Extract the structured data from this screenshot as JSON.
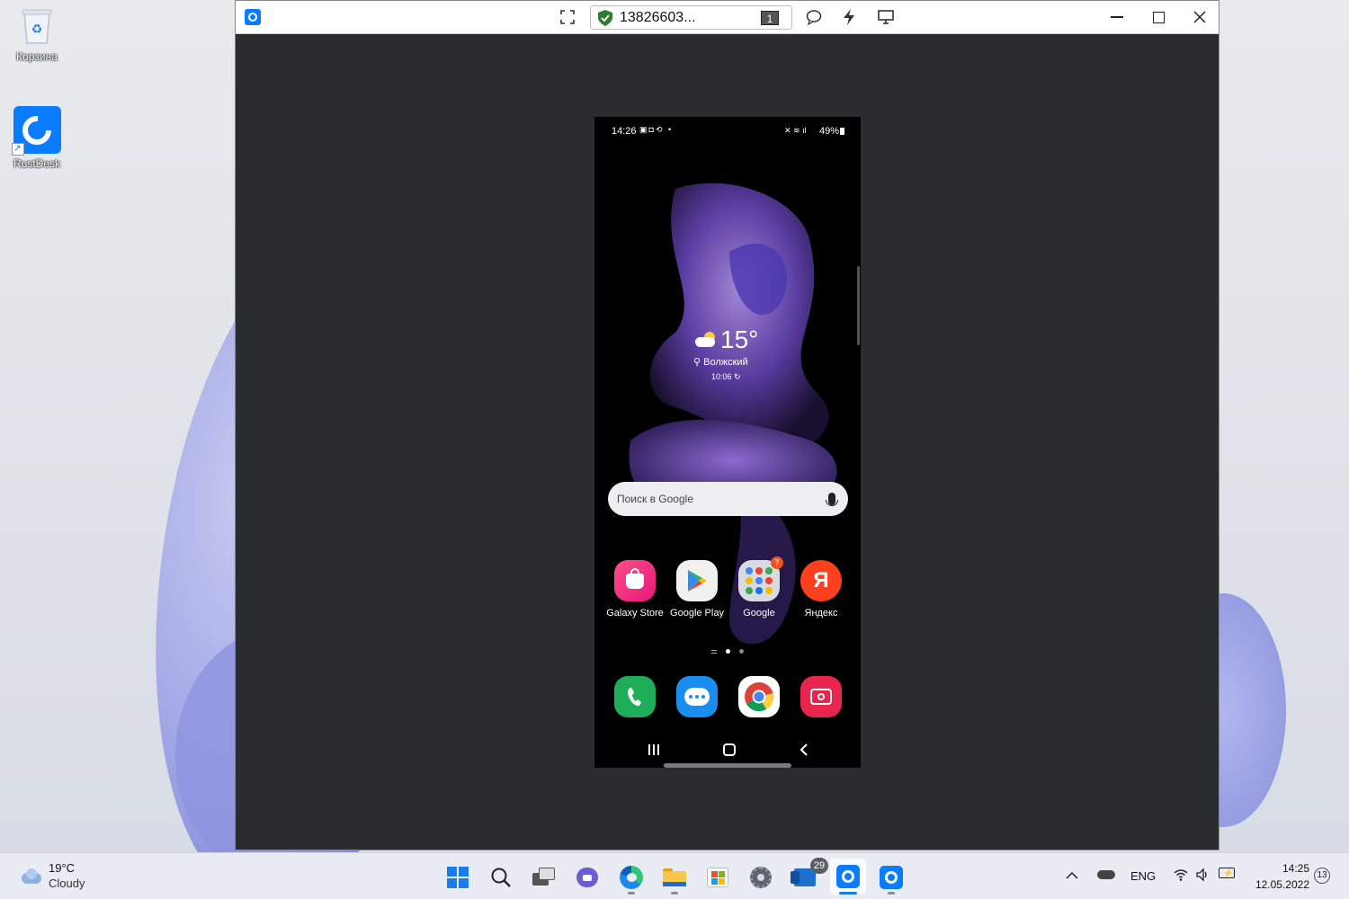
{
  "desktop": {
    "icons": [
      {
        "label": "Корзина",
        "icon": "recycle-bin-icon"
      },
      {
        "label": "RustDesk",
        "icon": "rustdesk-icon"
      }
    ]
  },
  "window": {
    "peer_id": "13826603...",
    "monitor_count": "1",
    "toolbar_icons": [
      "fullscreen-icon",
      "shield-icon",
      "chat-icon",
      "lightning-icon",
      "display-icon"
    ],
    "controls": [
      "minimize",
      "maximize",
      "close"
    ]
  },
  "phone": {
    "status": {
      "time": "14:26",
      "battery": "49%"
    },
    "weather": {
      "temp": "15°",
      "city": "Волжский",
      "updated": "10:06"
    },
    "search_placeholder": "Поиск в Google",
    "apps": [
      {
        "name": "Galaxy Store",
        "icon": "galaxy-store-icon"
      },
      {
        "name": "Google Play",
        "icon": "google-play-icon"
      },
      {
        "name": "Google",
        "icon": "google-folder-icon",
        "badge": "7"
      },
      {
        "name": "Яндекс",
        "icon": "yandex-icon",
        "glyph": "Я"
      }
    ],
    "dock": [
      "phone-icon",
      "messages-icon",
      "chrome-icon",
      "camera-icon"
    ]
  },
  "taskbar": {
    "weather_temp": "19°C",
    "weather_desc": "Cloudy",
    "apps": [
      "start",
      "search",
      "task-view",
      "teams-chat",
      "edge",
      "file-explorer",
      "microsoft-store",
      "settings",
      "mail",
      "rustdesk",
      "rustdesk"
    ],
    "mail_badge": "29",
    "language": "ENG",
    "time": "14:25",
    "date": "12.05.2022",
    "notification_count": "13"
  },
  "colors": {
    "accent": "#0071ff",
    "taskbar_bg": "#e9ecf2",
    "window_bg": "#2b2c2f"
  }
}
